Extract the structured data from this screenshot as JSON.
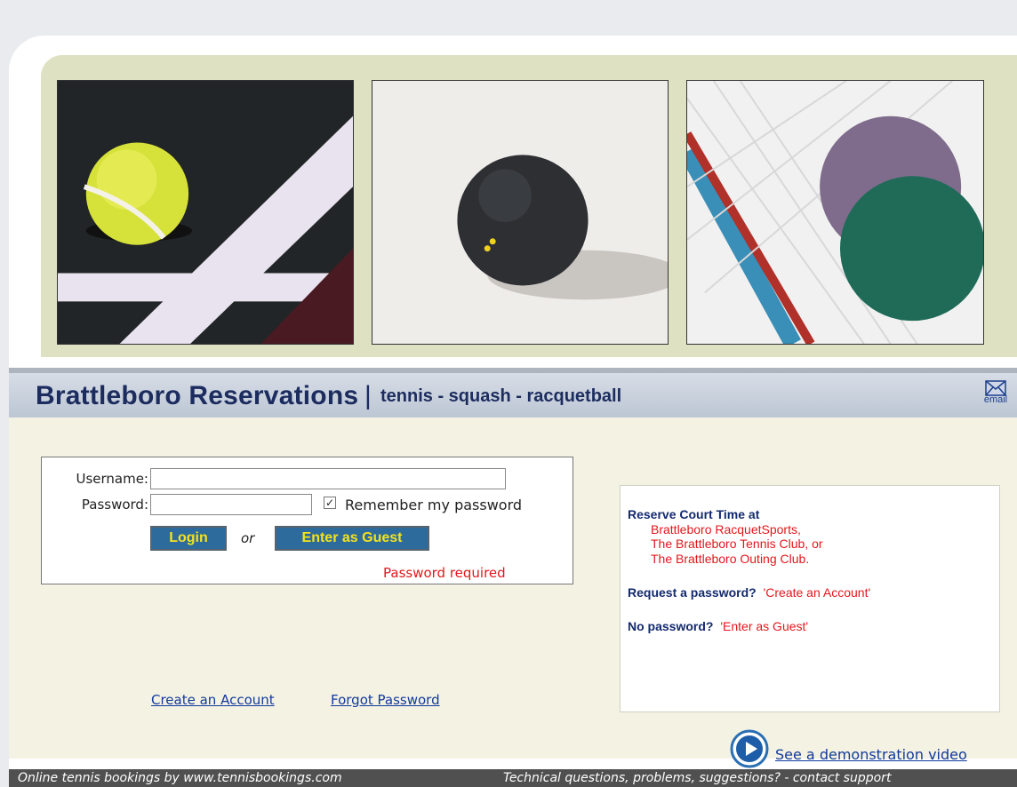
{
  "header": {
    "site_title": "Brattleboro Reservations",
    "separator": "|",
    "subtitle": "tennis - squash - racquetball",
    "email_label": "email"
  },
  "images": {
    "photo_1": "tennis-ball-photo",
    "photo_2": "squash-ball-photo",
    "photo_3": "racquetball-photo"
  },
  "login": {
    "username_label": "Username:",
    "password_label": "Password:",
    "username_value": "",
    "password_value": "",
    "remember_checked": true,
    "remember_mark": "✓",
    "remember_label": "Remember my password",
    "login_label": "Login",
    "or_label": "or",
    "guest_label": "Enter as Guest",
    "error_message": "Password required"
  },
  "links": {
    "create_account": "Create an Account",
    "forgot_password": "Forgot Password"
  },
  "info": {
    "heading": "Reserve Court Time at",
    "venues": [
      "Brattleboro RacquetSports,",
      "The Brattleboro Tennis Club, or",
      "The Brattleboro Outing Club."
    ],
    "request_label": "Request a password?",
    "request_link": "'Create an Account'",
    "nopass_label": "No password?",
    "nopass_link": "'Enter as Guest'"
  },
  "demo": {
    "label": "See a demonstration video"
  },
  "footer": {
    "left": "Online tennis bookings by www.tennisbookings.com",
    "right": "Technical questions, problems, suggestions? - contact support"
  },
  "colors": {
    "title_navy": "#1c2c5f",
    "button_blue": "#2d6b9c",
    "button_text": "#f4e21d",
    "error_red": "#e3171c",
    "link_blue": "#123a9c",
    "content_bg": "#f4f2e3",
    "band_bg": "#dfe2c2"
  }
}
